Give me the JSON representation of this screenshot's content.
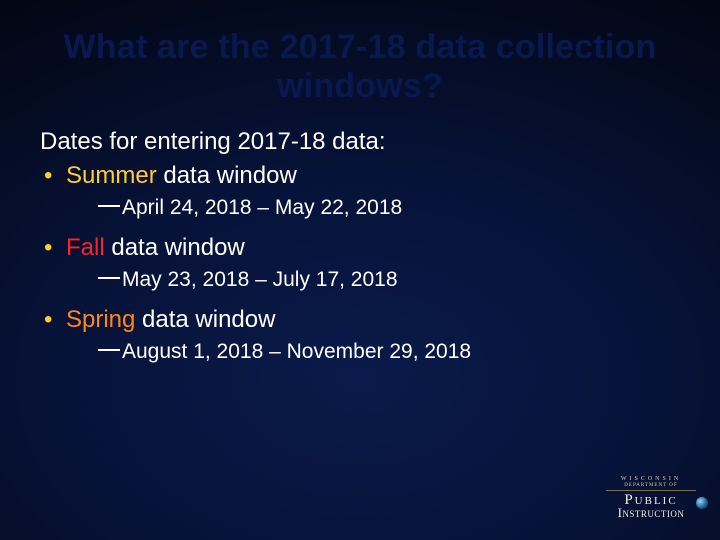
{
  "title": "What are the 2017-18 data collection windows?",
  "intro": "Dates for entering 2017-18 data:",
  "windows": [
    {
      "season": "Summer",
      "season_class": "summer",
      "rest": " data window",
      "range": "April 24, 2018 – May 22, 2018"
    },
    {
      "season": "Fall",
      "season_class": "fall",
      "rest": " data window",
      "range": "May 23, 2018 – July 17, 2018"
    },
    {
      "season": "Spring",
      "season_class": "spring",
      "rest": " data window",
      "range": "August 1, 2018 – November 29, 2018"
    }
  ],
  "logo": {
    "line1": "WISCONSIN",
    "line2": "DEPARTMENT OF",
    "line3": "Public",
    "line4": "Instruction"
  }
}
